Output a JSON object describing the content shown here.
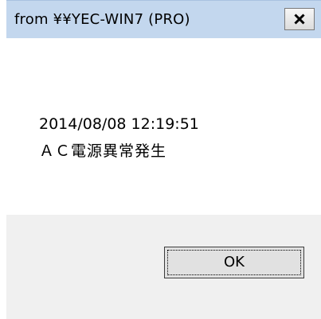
{
  "dialog": {
    "title": "from ¥¥YEC-WIN7 (PRO)",
    "close_icon": "close-icon",
    "message": {
      "line1": "2014/08/08 12:19:51",
      "line2": "ＡＣ電源異常発生"
    },
    "ok_label": "OK"
  },
  "colors": {
    "titlebar": "#c3d7ee",
    "content_bg": "#ffffff",
    "footer_bg": "#f0f0f0",
    "button_face": "#e1e1e1"
  }
}
